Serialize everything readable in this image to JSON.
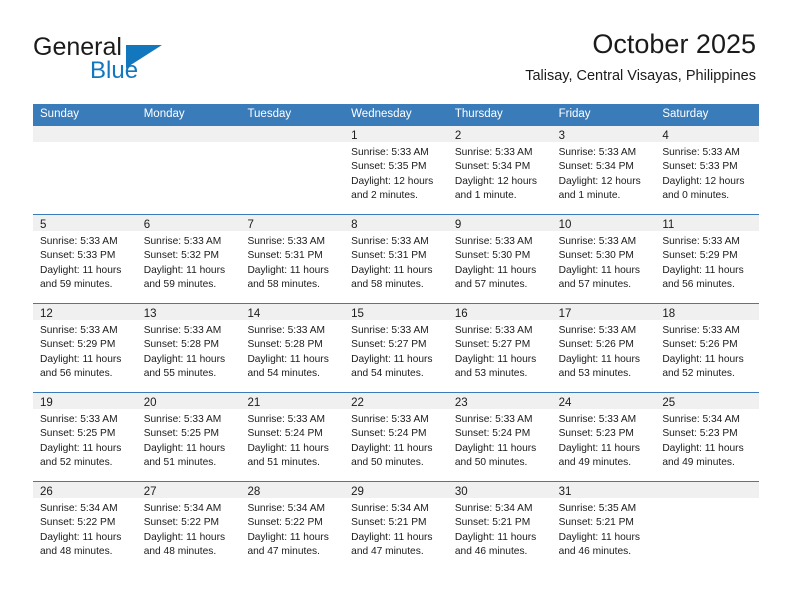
{
  "brand": {
    "name_part1": "General",
    "name_part2": "Blue",
    "flag_icon": "triangle-flag-icon"
  },
  "header": {
    "month_title": "October 2025",
    "location": "Talisay, Central Visayas, Philippines"
  },
  "theme": {
    "header_blue": "#3a7cba",
    "brand_blue": "#1277bd",
    "date_band_gray": "#f0f0f0",
    "text_black": "#1b1b1b"
  },
  "calendar": {
    "weekday_headers": [
      "Sunday",
      "Monday",
      "Tuesday",
      "Wednesday",
      "Thursday",
      "Friday",
      "Saturday"
    ],
    "weeks": [
      [
        {
          "day": "",
          "lines": []
        },
        {
          "day": "",
          "lines": []
        },
        {
          "day": "",
          "lines": []
        },
        {
          "day": "1",
          "lines": [
            "Sunrise: 5:33 AM",
            "Sunset: 5:35 PM",
            "Daylight: 12 hours",
            "and 2 minutes."
          ]
        },
        {
          "day": "2",
          "lines": [
            "Sunrise: 5:33 AM",
            "Sunset: 5:34 PM",
            "Daylight: 12 hours",
            "and 1 minute."
          ]
        },
        {
          "day": "3",
          "lines": [
            "Sunrise: 5:33 AM",
            "Sunset: 5:34 PM",
            "Daylight: 12 hours",
            "and 1 minute."
          ]
        },
        {
          "day": "4",
          "lines": [
            "Sunrise: 5:33 AM",
            "Sunset: 5:33 PM",
            "Daylight: 12 hours",
            "and 0 minutes."
          ]
        }
      ],
      [
        {
          "day": "5",
          "lines": [
            "Sunrise: 5:33 AM",
            "Sunset: 5:33 PM",
            "Daylight: 11 hours",
            "and 59 minutes."
          ]
        },
        {
          "day": "6",
          "lines": [
            "Sunrise: 5:33 AM",
            "Sunset: 5:32 PM",
            "Daylight: 11 hours",
            "and 59 minutes."
          ]
        },
        {
          "day": "7",
          "lines": [
            "Sunrise: 5:33 AM",
            "Sunset: 5:31 PM",
            "Daylight: 11 hours",
            "and 58 minutes."
          ]
        },
        {
          "day": "8",
          "lines": [
            "Sunrise: 5:33 AM",
            "Sunset: 5:31 PM",
            "Daylight: 11 hours",
            "and 58 minutes."
          ]
        },
        {
          "day": "9",
          "lines": [
            "Sunrise: 5:33 AM",
            "Sunset: 5:30 PM",
            "Daylight: 11 hours",
            "and 57 minutes."
          ]
        },
        {
          "day": "10",
          "lines": [
            "Sunrise: 5:33 AM",
            "Sunset: 5:30 PM",
            "Daylight: 11 hours",
            "and 57 minutes."
          ]
        },
        {
          "day": "11",
          "lines": [
            "Sunrise: 5:33 AM",
            "Sunset: 5:29 PM",
            "Daylight: 11 hours",
            "and 56 minutes."
          ]
        }
      ],
      [
        {
          "day": "12",
          "lines": [
            "Sunrise: 5:33 AM",
            "Sunset: 5:29 PM",
            "Daylight: 11 hours",
            "and 56 minutes."
          ]
        },
        {
          "day": "13",
          "lines": [
            "Sunrise: 5:33 AM",
            "Sunset: 5:28 PM",
            "Daylight: 11 hours",
            "and 55 minutes."
          ]
        },
        {
          "day": "14",
          "lines": [
            "Sunrise: 5:33 AM",
            "Sunset: 5:28 PM",
            "Daylight: 11 hours",
            "and 54 minutes."
          ]
        },
        {
          "day": "15",
          "lines": [
            "Sunrise: 5:33 AM",
            "Sunset: 5:27 PM",
            "Daylight: 11 hours",
            "and 54 minutes."
          ]
        },
        {
          "day": "16",
          "lines": [
            "Sunrise: 5:33 AM",
            "Sunset: 5:27 PM",
            "Daylight: 11 hours",
            "and 53 minutes."
          ]
        },
        {
          "day": "17",
          "lines": [
            "Sunrise: 5:33 AM",
            "Sunset: 5:26 PM",
            "Daylight: 11 hours",
            "and 53 minutes."
          ]
        },
        {
          "day": "18",
          "lines": [
            "Sunrise: 5:33 AM",
            "Sunset: 5:26 PM",
            "Daylight: 11 hours",
            "and 52 minutes."
          ]
        }
      ],
      [
        {
          "day": "19",
          "lines": [
            "Sunrise: 5:33 AM",
            "Sunset: 5:25 PM",
            "Daylight: 11 hours",
            "and 52 minutes."
          ]
        },
        {
          "day": "20",
          "lines": [
            "Sunrise: 5:33 AM",
            "Sunset: 5:25 PM",
            "Daylight: 11 hours",
            "and 51 minutes."
          ]
        },
        {
          "day": "21",
          "lines": [
            "Sunrise: 5:33 AM",
            "Sunset: 5:24 PM",
            "Daylight: 11 hours",
            "and 51 minutes."
          ]
        },
        {
          "day": "22",
          "lines": [
            "Sunrise: 5:33 AM",
            "Sunset: 5:24 PM",
            "Daylight: 11 hours",
            "and 50 minutes."
          ]
        },
        {
          "day": "23",
          "lines": [
            "Sunrise: 5:33 AM",
            "Sunset: 5:24 PM",
            "Daylight: 11 hours",
            "and 50 minutes."
          ]
        },
        {
          "day": "24",
          "lines": [
            "Sunrise: 5:33 AM",
            "Sunset: 5:23 PM",
            "Daylight: 11 hours",
            "and 49 minutes."
          ]
        },
        {
          "day": "25",
          "lines": [
            "Sunrise: 5:34 AM",
            "Sunset: 5:23 PM",
            "Daylight: 11 hours",
            "and 49 minutes."
          ]
        }
      ],
      [
        {
          "day": "26",
          "lines": [
            "Sunrise: 5:34 AM",
            "Sunset: 5:22 PM",
            "Daylight: 11 hours",
            "and 48 minutes."
          ]
        },
        {
          "day": "27",
          "lines": [
            "Sunrise: 5:34 AM",
            "Sunset: 5:22 PM",
            "Daylight: 11 hours",
            "and 48 minutes."
          ]
        },
        {
          "day": "28",
          "lines": [
            "Sunrise: 5:34 AM",
            "Sunset: 5:22 PM",
            "Daylight: 11 hours",
            "and 47 minutes."
          ]
        },
        {
          "day": "29",
          "lines": [
            "Sunrise: 5:34 AM",
            "Sunset: 5:21 PM",
            "Daylight: 11 hours",
            "and 47 minutes."
          ]
        },
        {
          "day": "30",
          "lines": [
            "Sunrise: 5:34 AM",
            "Sunset: 5:21 PM",
            "Daylight: 11 hours",
            "and 46 minutes."
          ]
        },
        {
          "day": "31",
          "lines": [
            "Sunrise: 5:35 AM",
            "Sunset: 5:21 PM",
            "Daylight: 11 hours",
            "and 46 minutes."
          ]
        },
        {
          "day": "",
          "lines": []
        }
      ]
    ]
  }
}
